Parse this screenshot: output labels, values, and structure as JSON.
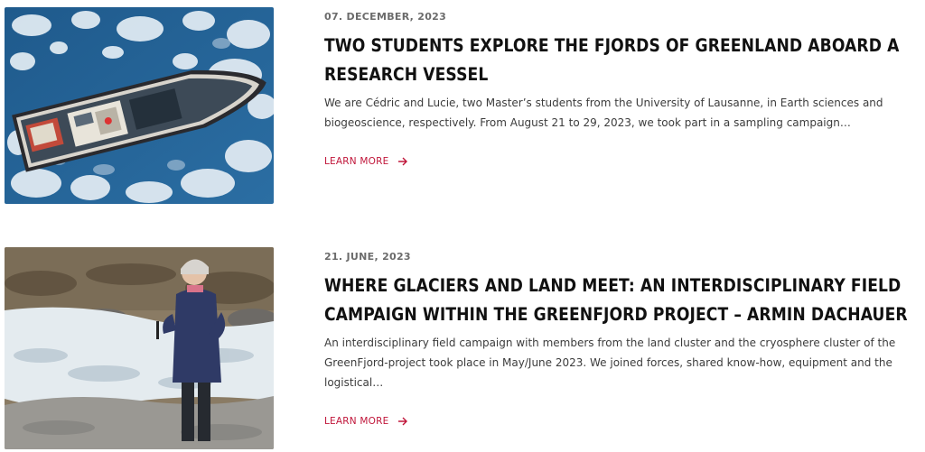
{
  "posts": [
    {
      "date": "07. DECEMBER, 2023",
      "title": "TWO STUDENTS EXPLORE THE FJORDS OF GREENLAND ABOARD A RESEARCH VESSEL",
      "excerpt": "We are Cédric and Lucie, two Master’s students from the University of Lausanne, in Earth sciences and biogeoscience, respectively. From August 21 to 29, 2023, we took part in a sampling campaign…",
      "link_label": "LEARN MORE",
      "image": "aerial-ship-in-sea-ice"
    },
    {
      "date": "21. JUNE, 2023",
      "title": "WHERE GLACIERS AND LAND MEET: AN INTERDISCIPLINARY FIELD CAMPAIGN WITHIN THE GREENFJORD PROJECT – ARMIN DACHAUER",
      "excerpt": "An interdisciplinary field campaign with members from the land cluster and the cryosphere cluster of the GreenFjord-project took place in May/June 2023. We joined forces, shared know-how, equipment and the logistical…",
      "link_label": "LEARN MORE",
      "image": "researcher-by-glacial-stream"
    }
  ],
  "colors": {
    "accent": "#c0163a",
    "title": "#111111",
    "date": "#6b6b6b",
    "body": "#3c3c3c"
  }
}
